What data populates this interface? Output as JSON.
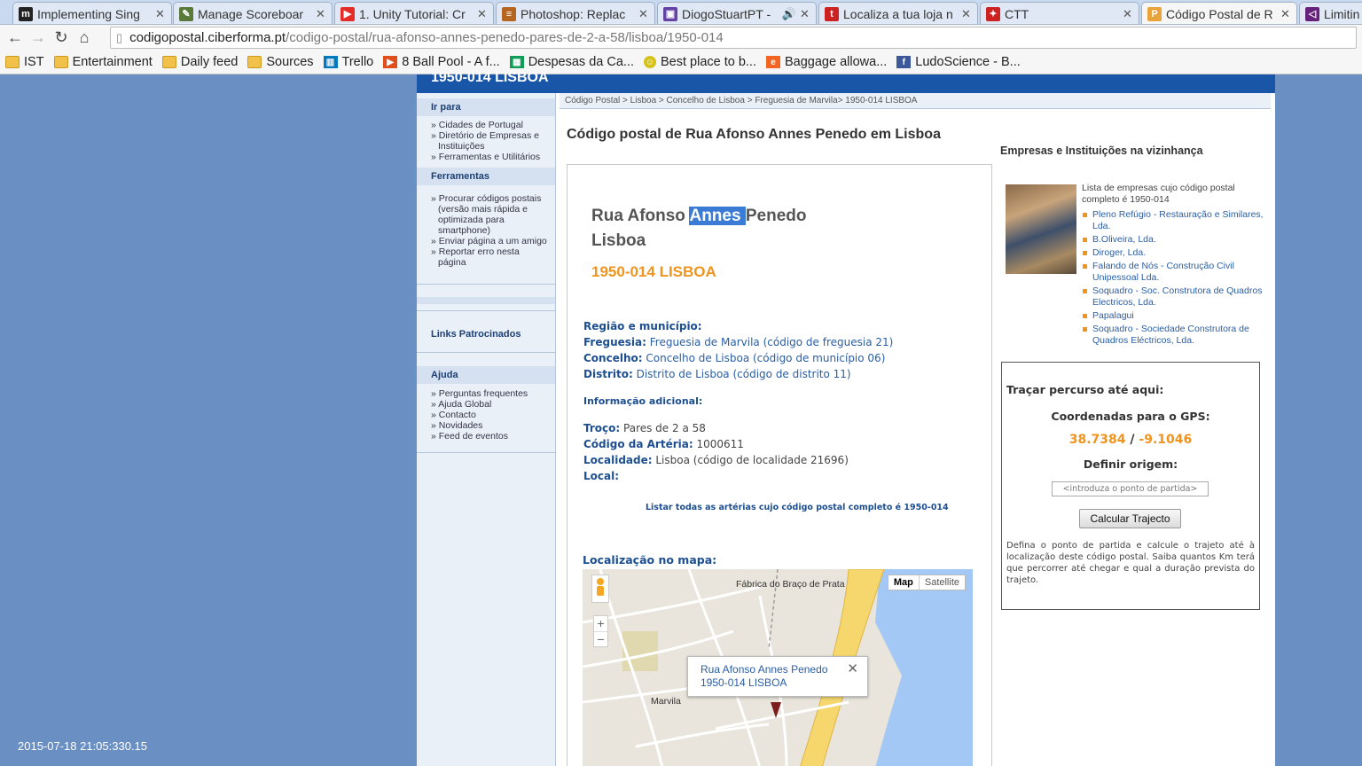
{
  "tabs": [
    {
      "title": "Implementing Sing",
      "icon": "medium-icon",
      "color": "#222222"
    },
    {
      "title": "Manage Scoreboar",
      "icon": "scoreboard-icon",
      "color": "#5a7a3a"
    },
    {
      "title": "1. Unity Tutorial: Cr",
      "icon": "youtube-icon",
      "color": "#e52d27"
    },
    {
      "title": "Photoshop: Replac",
      "icon": "stackexchange-icon",
      "color": "#b5651d"
    },
    {
      "title": "DiogoStuartPT -",
      "icon": "twitch-icon",
      "color": "#6441a5"
    },
    {
      "title": "Localiza a tua loja n",
      "icon": "t-logo-icon",
      "color": "#cc2222"
    },
    {
      "title": "CTT",
      "icon": "ctt-icon",
      "color": "#cc2222"
    },
    {
      "title": "Código Postal de R",
      "icon": "postal-icon",
      "color": "#e8a33a"
    },
    {
      "title": "Limitin",
      "icon": "vs-icon",
      "color": "#68217a"
    }
  ],
  "url": {
    "host": "codigopostal.ciberforma.pt",
    "path": "/codigo-postal/rua-afonso-annes-penedo-pares-de-2-a-58/lisboa/1950-014"
  },
  "bookmarks": [
    {
      "label": "IST",
      "type": "folder"
    },
    {
      "label": "Entertainment",
      "type": "folder"
    },
    {
      "label": "Daily feed",
      "type": "folder"
    },
    {
      "label": "Sources",
      "type": "folder"
    },
    {
      "label": "Trello",
      "type": "trello"
    },
    {
      "label": "8 Ball Pool - A f...",
      "type": "pool"
    },
    {
      "label": "Despesas da Ca...",
      "type": "sheets"
    },
    {
      "label": "Best place to b...",
      "type": "smiley"
    },
    {
      "label": "Baggage allowa...",
      "type": "baggage"
    },
    {
      "label": "LudoScience - B...",
      "type": "facebook"
    }
  ],
  "page": {
    "top_title": "1950-014 LISBOA"
  },
  "sidebar": {
    "sec1": "Ir para",
    "sec1_items": [
      "Cidades de Portugal",
      "Diretório de Empresas e Instituições",
      "Ferramentas e Utilitários"
    ],
    "sec2": "Ferramentas",
    "sec2_items": [
      "Procurar códigos postais (versão mais rápida e optimizada para smartphone)",
      "Enviar página a um amigo",
      "Reportar erro nesta página"
    ],
    "sec3": "Links Patrocinados",
    "sec4": "Ajuda",
    "sec4_items": [
      "Perguntas frequentes",
      "Ajuda Global",
      "Contacto",
      "Novidades",
      "Feed de eventos"
    ]
  },
  "breadcrumb": "Código Postal > Lisboa > Concelho de Lisboa > Freguesia de Marvila> 1950-014 LISBOA",
  "main": {
    "heading": "Código postal de Rua Afonso Annes Penedo em Lisboa",
    "street_before": "Rua Afonso ",
    "street_selected": "Annes ",
    "street_after": "Penedo",
    "city": "Lisboa",
    "postal": "1950-014 LISBOA",
    "region_label": "Região e município:",
    "freguesia_label": "Freguesia:",
    "freguesia_value": "Freguesia de Marvila (código de freguesia 21)",
    "concelho_label": "Concelho:",
    "concelho_value": "Concelho de Lisboa (código de município 06)",
    "distrito_label": "Distrito:",
    "distrito_value": "Distrito de Lisboa (código de distrito 11)",
    "info_label": "Informação adicional:",
    "troco_label": "Troço:",
    "troco_value": "Pares de 2 a 58",
    "arteria_label": "Código da Artéria:",
    "arteria_value": "1000611",
    "localidade_label": "Localidade:",
    "localidade_value": "Lisboa (código de localidade 21696)",
    "local_label": "Local:",
    "list_link": "Listar todas as artérias cujo código postal completo é 1950-014",
    "map_title": "Localização no mapa:"
  },
  "map": {
    "btn_map": "Map",
    "btn_satellite": "Satellite",
    "label_fabrica": "Fábrica do Braço de Prata",
    "label_marvila": "Marvila",
    "bubble_line1": "Rua Afonso Annes Penedo",
    "bubble_line2": "1950-014 LISBOA"
  },
  "right": {
    "title": "Empresas e Instituições na vizinhança",
    "intro": "Lista de empresas cujo código postal completo é 1950-014",
    "companies": [
      "Pleno Refúgio - Restauração e Similares, Lda.",
      "B.Oliveira, Lda.",
      "Diroger, Lda.",
      "Falando de Nós - Construção Civil Unipessoal Lda.",
      "Soquadro - Soc. Construtora de Quadros Electricos, Lda.",
      "Papalagui",
      "Soquadro - Sociedade Construtora de Quadros Eléctricos, Lda."
    ]
  },
  "gps": {
    "route_label": "Traçar percurso até aqui:",
    "coords_label": "Coordenadas para o GPS:",
    "lat": "38.7384",
    "sep": "/",
    "lon": "-9.1046",
    "origin_label": "Definir origem:",
    "origin_placeholder": "<introduza o ponto de partida>",
    "button": "Calcular Trajecto",
    "desc": "Defina o ponto de partida e calcule o trajeto até à localização deste código postal. Saiba quantos Km terá que percorrer até chegar e qual a duração prevista do trajeto."
  },
  "timestamp": "2015-07-18 21:05:330.15"
}
